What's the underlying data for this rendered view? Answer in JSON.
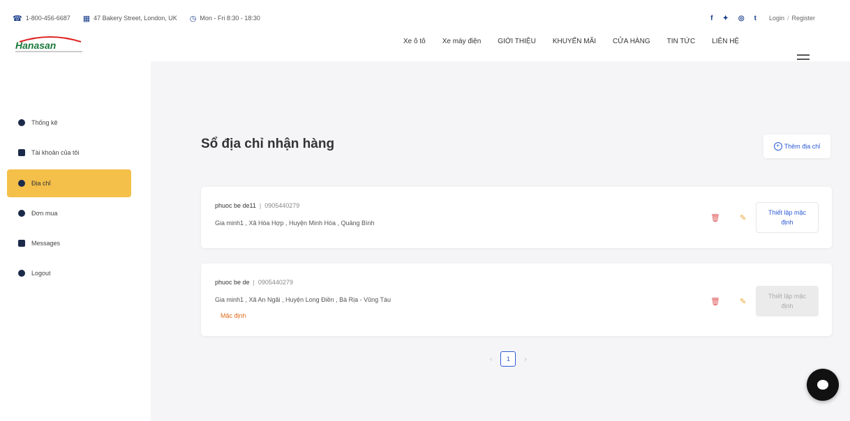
{
  "topbar": {
    "phone": "1-800-456-6687",
    "address": "47 Bakery Street, London, UK",
    "hours": "Mon - Fri 8:30 - 18:30",
    "login_label": "Login",
    "register_label": "Register",
    "social_icons": [
      "facebook-icon",
      "twitter-icon",
      "instagram-icon",
      "tumblr-icon"
    ]
  },
  "header": {
    "logo_text": "Hanasan",
    "nav": [
      "Xe ô tô",
      "Xe máy điện",
      "GIỚI THIỆU",
      "KHUYẾN MÃI",
      "CỬA HÀNG",
      "TIN TỨC",
      "LIÊN HỆ"
    ]
  },
  "sidebar": {
    "items": [
      {
        "label": "Thống kê",
        "icon": "chart-icon",
        "active": false
      },
      {
        "label": "Tài khoản của tôi",
        "icon": "user-icon",
        "active": false
      },
      {
        "label": "Địa chỉ",
        "icon": "location-pin-icon",
        "active": true
      },
      {
        "label": "Đơn mua",
        "icon": "order-icon",
        "active": false
      },
      {
        "label": "Messages",
        "icon": "message-icon",
        "active": false
      },
      {
        "label": "Logout",
        "icon": "logout-icon",
        "active": false
      }
    ]
  },
  "main": {
    "title": "Sổ địa chỉ nhận hàng",
    "add_label": "Thêm địa chỉ",
    "addresses": [
      {
        "name": "phuoc be de11",
        "phone": "0905440279",
        "address": "Gia minh1 , Xã Hòa Hợp , Huyện Minh Hóa , Quảng Bình",
        "is_default": false,
        "set_default_label": "Thiết lập mặc định"
      },
      {
        "name": "phuoc be de",
        "phone": "0905440279",
        "address": "Gia minh1 , Xã An Ngãi , Huyện Long Điền , Bà Rịa - Vũng Tàu",
        "is_default": true,
        "default_label": "Mặc định",
        "set_default_label": "Thiết lập mặc định"
      }
    ],
    "pagination": {
      "current": "1",
      "prev": "‹",
      "next": "›"
    }
  },
  "colors": {
    "accent": "#f4c04a",
    "link": "#2d5bd6",
    "default_tag": "#e06b1a",
    "delete": "#e05a5a",
    "edit": "#f0a030"
  }
}
